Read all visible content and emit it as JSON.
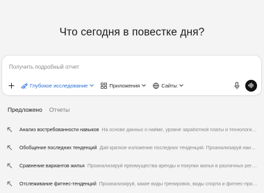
{
  "heading": "Что сегодня в повестке дня?",
  "composer": {
    "prompt": "Получить подробный отчет",
    "tools": [
      {
        "label": "Глубокое исследование",
        "icon": "telescope-icon",
        "active": true
      },
      {
        "label": "Приложения",
        "icon": "apps-icon",
        "active": false
      },
      {
        "label": "Сайты",
        "icon": "globe-icon",
        "active": false
      }
    ],
    "accent": "#2b6fd6"
  },
  "tabs": [
    {
      "label": "Предложено",
      "selected": true
    },
    {
      "label": "Отчеты",
      "selected": false
    }
  ],
  "suggestions": [
    {
      "title": "Анализ востребованности навыков",
      "description": "На основе данных о найме, уровне заработной платы и технологическ..."
    },
    {
      "title": "Обобщение последних тенденций",
      "description": "Дай краткое изложение последних тенденций. Проанализируй наиболе..."
    },
    {
      "title": "Сравнение вариантов жилья",
      "description": "Проанализируй преимущества аренды и покупки жилья в различных регион..."
    },
    {
      "title": "Отслеживание фитнес-тенденций",
      "description": "Проанализируй, какие виды тренировок, виды спорта и фитнес-продукты..."
    }
  ]
}
